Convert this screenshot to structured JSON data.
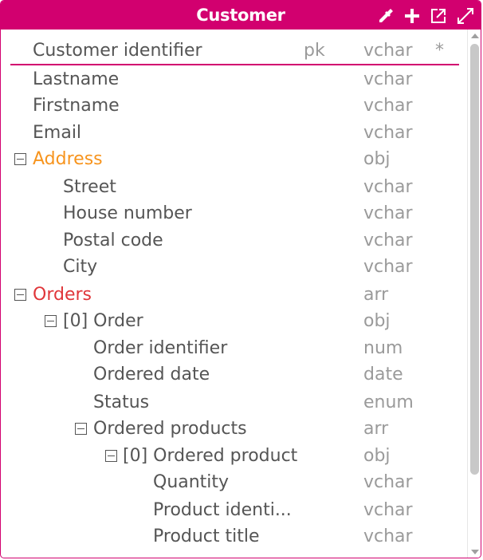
{
  "entity": {
    "title": "Customer",
    "colors": {
      "primary": "#d2006f",
      "text": "#555555",
      "muted": "#9a9a9a",
      "object_name": "#f7941d",
      "array_name": "#e0363a"
    },
    "toolbar_icons": [
      "eyedropper-icon",
      "plus-icon",
      "open-external-icon",
      "expand-icon"
    ],
    "rows": [
      {
        "name": "Customer identifier",
        "key": "pk",
        "type": "vchar",
        "required": "*"
      },
      {
        "name": "Lastname",
        "type": "vchar"
      },
      {
        "name": "Firstname",
        "type": "vchar"
      },
      {
        "name": "Email",
        "type": "vchar"
      },
      {
        "name": "Address",
        "type": "obj"
      },
      {
        "name": "Street",
        "type": "vchar"
      },
      {
        "name": "House number",
        "type": "vchar"
      },
      {
        "name": "Postal code",
        "type": "vchar"
      },
      {
        "name": "City",
        "type": "vchar"
      },
      {
        "name": "Orders",
        "type": "arr"
      },
      {
        "name": "[0] Order",
        "type": "obj"
      },
      {
        "name": "Order identifier",
        "type": "num"
      },
      {
        "name": "Ordered date",
        "type": "date"
      },
      {
        "name": "Status",
        "type": "enum"
      },
      {
        "name": "Ordered products",
        "type": "arr"
      },
      {
        "name": "[0] Ordered product",
        "type": "obj"
      },
      {
        "name": "Quantity",
        "type": "vchar"
      },
      {
        "name": "Product identi...",
        "type": "vchar"
      },
      {
        "name": "Product title",
        "type": "vchar"
      }
    ]
  }
}
